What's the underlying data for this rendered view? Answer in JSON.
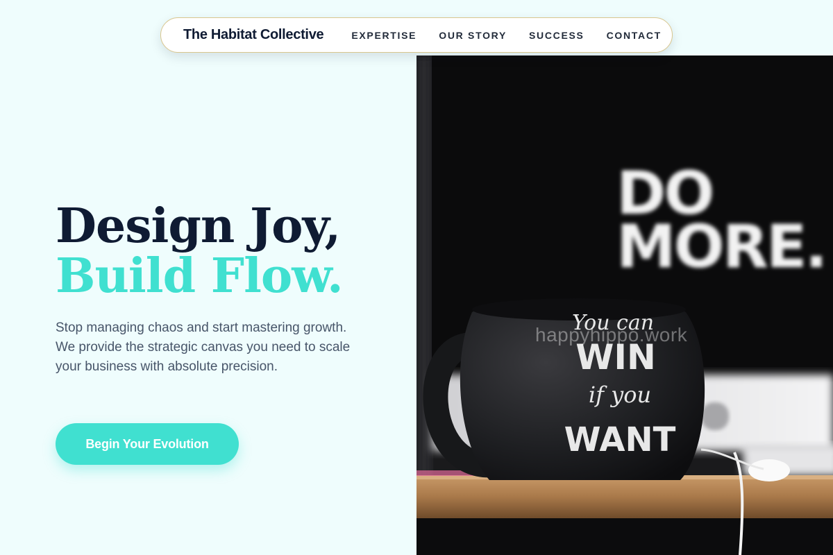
{
  "nav": {
    "brand": "The Habitat Collective",
    "links": [
      {
        "label": "EXPERTISE"
      },
      {
        "label": "OUR STORY"
      },
      {
        "label": "SUCCESS"
      },
      {
        "label": "CONTACT"
      }
    ]
  },
  "hero": {
    "title_line1": "Design Joy,",
    "title_line2": "Build Flow.",
    "subtitle": "Stop managing chaos and start mastering growth. We provide the strategic canvas you need to scale your business with absolute precision.",
    "cta_label": "Begin Your Evolution"
  },
  "photo": {
    "screen_text": [
      "DO",
      "MORE."
    ],
    "mug_text": [
      "You can",
      "WIN",
      "if you",
      "WANT"
    ],
    "watermark": "happyhippo.work"
  },
  "colors": {
    "page_bg": "#effdfd",
    "navy": "#0f1b33",
    "accent": "#40e0d0",
    "body_text": "#475569",
    "nav_border": "#d8c68d"
  }
}
